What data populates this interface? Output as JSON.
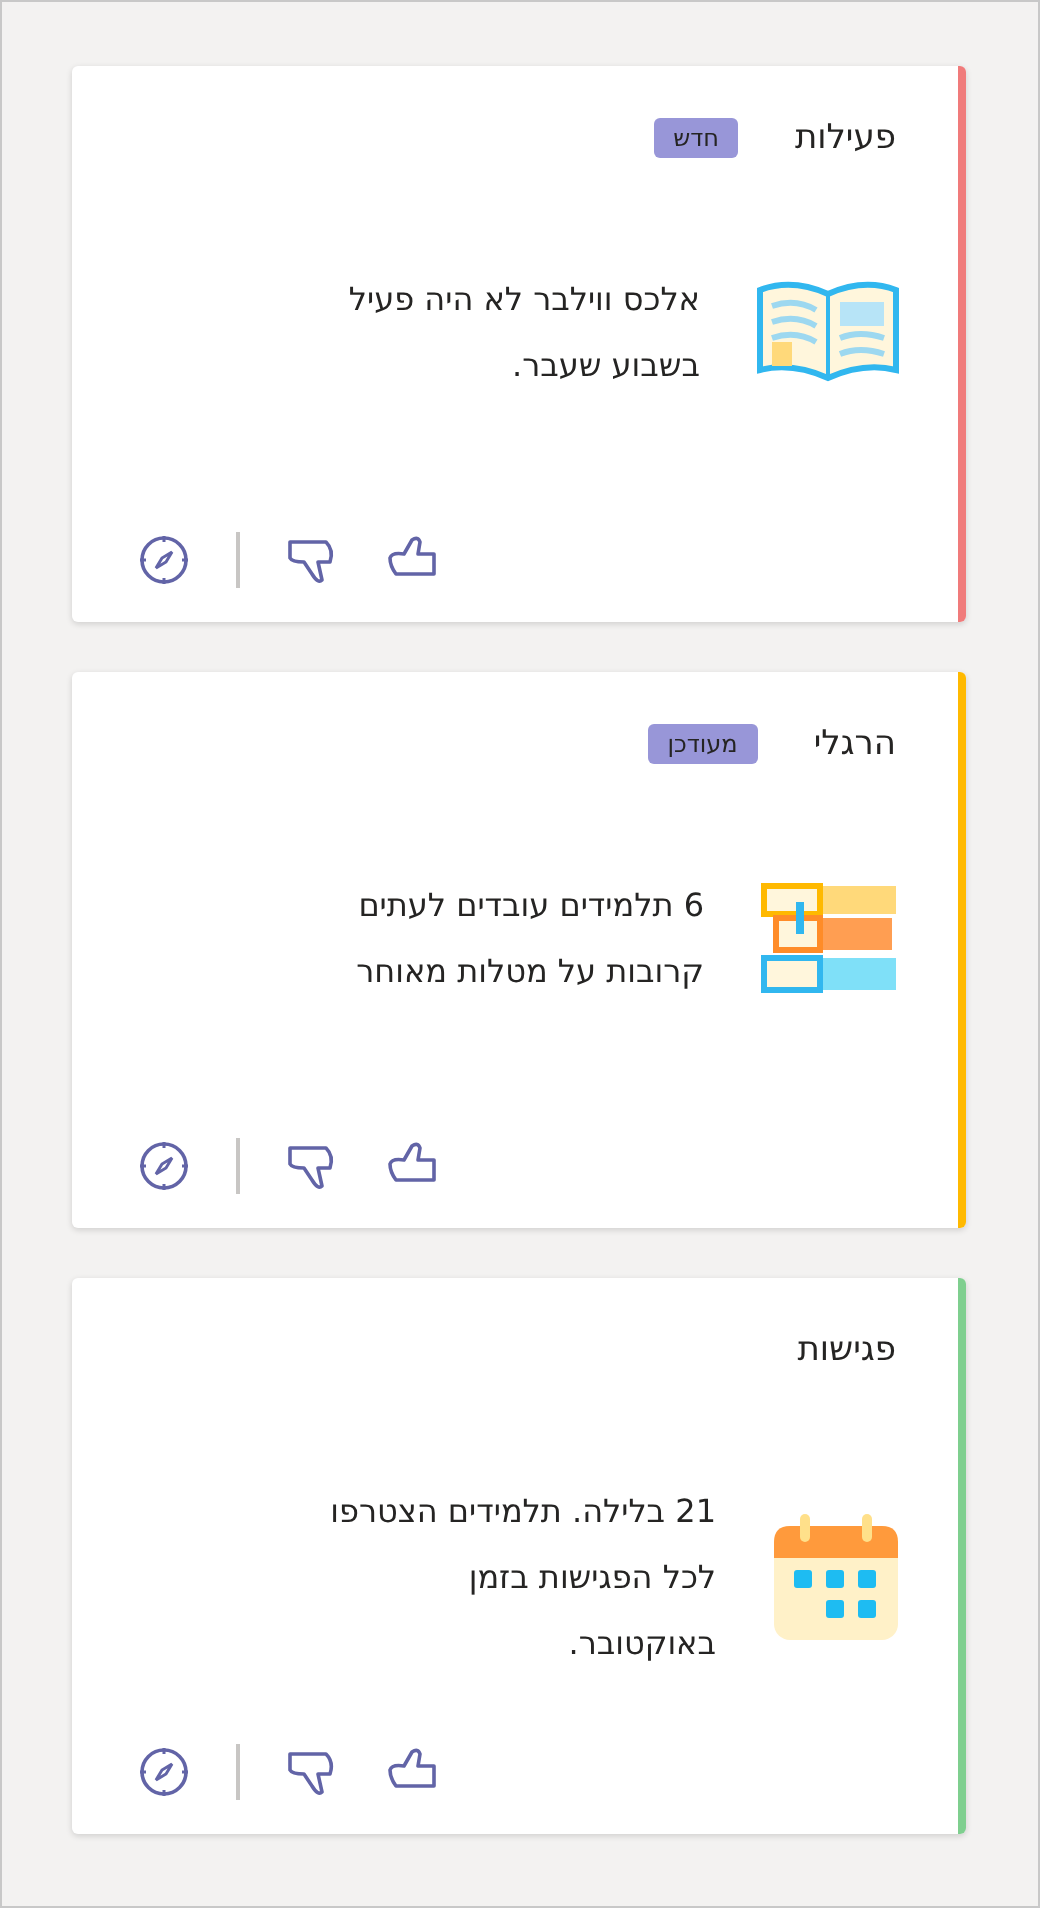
{
  "cards": [
    {
      "kind": "book",
      "title": "פעילות",
      "badge": "חדש",
      "color": "#f07b7b",
      "lines": [
        "אלכס ווילבר לא היה פעיל",
        "בשבוע שעבר."
      ]
    },
    {
      "kind": "books",
      "title": "הרגלי",
      "badge": "מעודכן",
      "color": "#ffb900",
      "lines": [
        "6 תלמידים עובדים לעתים",
        "קרובות על מטלות מאוחר"
      ]
    },
    {
      "kind": "calendar",
      "title": "פגישות",
      "color": "#7fcf8f",
      "lines": [
        "21 בלילה. תלמידים הצטרפו",
        "לכל הפגישות בזמן",
        "באוקטובר."
      ]
    }
  ]
}
